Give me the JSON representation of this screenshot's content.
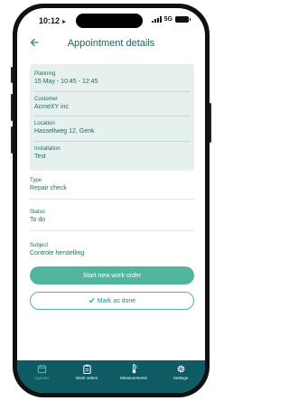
{
  "status": {
    "time": "10:12",
    "network": "5G"
  },
  "header": {
    "back_icon": "arrow-left-icon",
    "title": "Appointment details"
  },
  "details_card": {
    "planning": {
      "label": "Planning",
      "value": "15 May - 10:45 - 12:45"
    },
    "customer": {
      "label": "Customer",
      "value": "AcmeXY inc"
    },
    "location": {
      "label": "Location",
      "value": "Hasseltweg 12, Genk"
    },
    "installation": {
      "label": "Installation",
      "value": "Test"
    }
  },
  "fields": {
    "type": {
      "label": "Type",
      "value": "Repair check"
    },
    "status": {
      "label": "Status",
      "value": "To do"
    },
    "subject": {
      "label": "Subject",
      "value": "Controle herstelling"
    }
  },
  "actions": {
    "start_label": "Start new work order",
    "mark_done_label": "Mark as done",
    "mark_done_icon": "check-icon"
  },
  "tabbar": {
    "tabs": [
      {
        "label": "Agenda",
        "icon": "calendar-icon",
        "active": true
      },
      {
        "label": "Work orders",
        "icon": "clipboard-icon",
        "active": false
      },
      {
        "label": "Measurements",
        "icon": "thermometer-icon",
        "active": false
      },
      {
        "label": "Settings",
        "icon": "gear-icon",
        "active": false
      }
    ]
  },
  "colors": {
    "primary": "#52b59e",
    "title_text": "#16665a",
    "card_bg": "#e6f0ef",
    "tabbar_bg": "#0e5b63",
    "tab_active": "#5cc1a9"
  }
}
